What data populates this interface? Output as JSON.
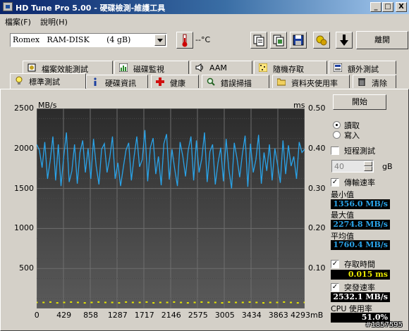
{
  "window": {
    "title": "HD Tune Pro  5.00 - 硬碟檢測-維護工具",
    "minimize": "_",
    "maximize": "□",
    "close": "X"
  },
  "menu": [
    "檔案(F)",
    "說明(H)"
  ],
  "toolbar": {
    "drive": "Romex   RAM-DISK       (4 gB)",
    "temperature": "--°C",
    "exit_label": "離開",
    "icons": [
      "thermometer-icon",
      "copy-text-icon",
      "copy-image-icon",
      "save-icon",
      "options-icon",
      "download-icon"
    ]
  },
  "tabs_back": [
    "檔案效能測試",
    "磁碟監視",
    "AAM",
    "隨機存取",
    "額外測試"
  ],
  "tabs_front": [
    "標準測試",
    "硬碟資訊",
    "健康",
    "錯誤掃描",
    "資料夾使用率",
    "清除"
  ],
  "chart_data": {
    "type": "line",
    "y_left_unit": "MB/s",
    "y_right_unit": "ms",
    "x_unit": "mB",
    "y_left_ticks": [
      "2500",
      "2000",
      "1500",
      "1000",
      "500"
    ],
    "y_right_ticks": [
      "0.50",
      "0.40",
      "0.30",
      "0.20",
      "0.10"
    ],
    "x_ticks": [
      "0",
      "429",
      "858",
      "1287",
      "1717",
      "2146",
      "2575",
      "3005",
      "3434",
      "3863",
      "4293mB"
    ],
    "ylim_left": [
      0,
      2500
    ],
    "ylim_right": [
      0,
      0.5
    ],
    "xlim": [
      0,
      4293
    ],
    "grid": true,
    "series": [
      {
        "name": "",
        "axis": "left",
        "color": "#2aa3e8",
        "values": [
          2050,
          1980,
          1760,
          2080,
          1620,
          1850,
          2150,
          1600,
          2050,
          1530,
          1900,
          2200,
          1580,
          1720,
          2050,
          1560,
          1950,
          2100,
          1700,
          2000,
          1620,
          2120,
          1780,
          1550,
          1990,
          2060,
          1700,
          1880,
          2150,
          1620,
          1820,
          1530,
          1760,
          1980,
          2070,
          1600,
          1900,
          2150,
          1770,
          1860,
          2230,
          1590,
          2010,
          2130,
          1680,
          1900,
          1540,
          2060,
          2180,
          1610,
          1990,
          1740,
          1530,
          2080,
          1900,
          1650,
          1980,
          2150,
          1600,
          2100,
          1700,
          1870,
          2200,
          1580,
          1960,
          2050,
          1550,
          1820,
          2010,
          1590,
          2120,
          1740,
          1500,
          2070,
          1880,
          1640,
          1930,
          2160,
          1520,
          2060,
          1700,
          1860,
          2170,
          1560,
          1950,
          1720,
          2050,
          1600,
          2000,
          1800,
          1570,
          2100,
          1680,
          2040,
          1780,
          1900,
          1620,
          2080,
          1950,
          1990
        ]
      },
      {
        "name": "",
        "axis": "right",
        "color": "#e6e600",
        "values": [
          0.015,
          0.015,
          0.016,
          0.014,
          0.015,
          0.016,
          0.015,
          0.014,
          0.015,
          0.016,
          0.015,
          0.015,
          0.014,
          0.016,
          0.015,
          0.015,
          0.016,
          0.014,
          0.015,
          0.015,
          0.016,
          0.015,
          0.014,
          0.015,
          0.016,
          0.015,
          0.015,
          0.014,
          0.016,
          0.015,
          0.015,
          0.016,
          0.015,
          0.014,
          0.015,
          0.015,
          0.016,
          0.015,
          0.014,
          0.015
        ]
      }
    ]
  },
  "panel": {
    "start_label": "開始",
    "read_label": "讀取",
    "write_label": "寫入",
    "short_test_label": "短程測試",
    "short_test_value": "40",
    "short_test_unit": "gB",
    "transfer_label": "傳輸速率",
    "min_label": "最小值",
    "min_value": "1356.0 MB/s",
    "max_label": "最大值",
    "max_value": "2274.8 MB/s",
    "avg_label": "平均值",
    "avg_value": "1760.4 MB/s",
    "access_label": "存取時間",
    "access_value": "0.015 ms",
    "burst_label": "突發速率",
    "burst_value": "2532.1 MB/s",
    "cpu_label": "CPU 使用率",
    "cpu_value": "51.0%",
    "colors": {
      "min": "#2aa3e8",
      "max": "#2aa3e8",
      "avg": "#2aa3e8",
      "access": "#e6e600",
      "burst": "#ffffff",
      "cpu": "#ffffff"
    }
  },
  "watermark": "#1857595"
}
